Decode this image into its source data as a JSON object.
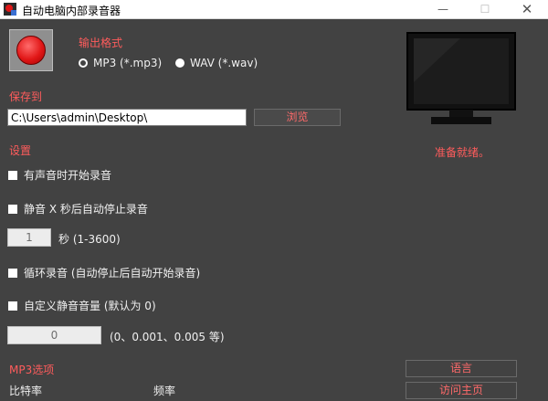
{
  "window": {
    "title": "自动电脑内部录音器",
    "minimize_glyph": "—",
    "maximize_glyph": "☐",
    "close_glyph": "✕"
  },
  "output_format": {
    "title": "输出格式",
    "options": [
      {
        "label": "MP3 (*.mp3)",
        "selected": true
      },
      {
        "label": "WAV (*.wav)",
        "selected": false
      }
    ]
  },
  "save_to": {
    "title": "保存到",
    "path_value": "C:\\Users\\admin\\Desktop\\",
    "browse_label": "浏览"
  },
  "settings": {
    "title": "设置",
    "start_on_sound_label": "有声音时开始录音",
    "stop_after_silence_label": "静音 X 秒后自动停止录音",
    "seconds_value": "1",
    "seconds_hint": "秒 (1-3600)",
    "loop_label": "循环录音 (自动停止后自动开始录音)",
    "custom_threshold_label": "自定义静音音量 (默认为 0)",
    "threshold_value": "0",
    "threshold_hint": "(0、0.001、0.005 等)"
  },
  "mp3_options": {
    "title": "MP3选项",
    "bitrate_label": "比特率",
    "frequency_label": "频率"
  },
  "sidebar": {
    "status_text": "准备就绪。",
    "language_label": "语言",
    "homepage_label": "访问主页"
  },
  "colors": {
    "background": "#424242",
    "accent_red": "#ff5c5c",
    "record_red": "#e11717"
  },
  "icons": [
    "app-icon",
    "record-icon",
    "monitor-icon"
  ]
}
